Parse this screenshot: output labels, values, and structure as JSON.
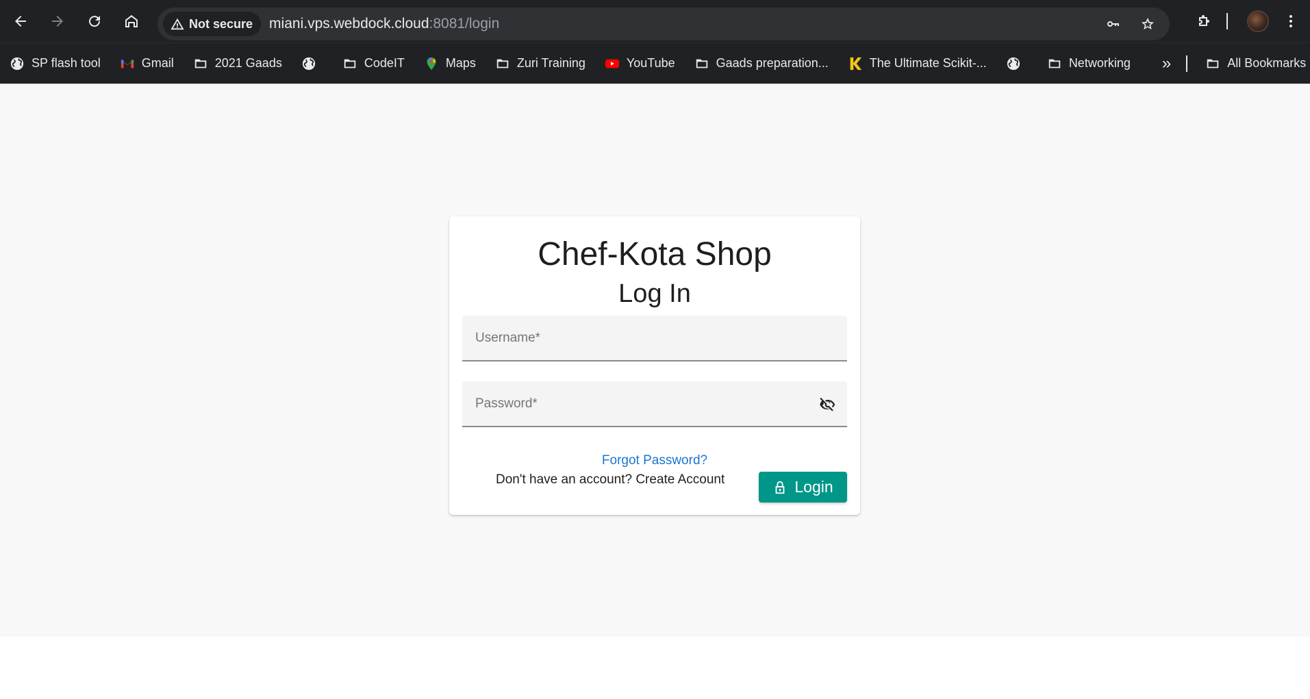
{
  "browser": {
    "security_label": "Not secure",
    "url_host": "miani.vps.webdock.cloud",
    "url_path": ":8081/login",
    "bookmarks": [
      {
        "label": "SP flash tool",
        "icon": "globe-icon"
      },
      {
        "label": "Gmail",
        "icon": "gmail-icon"
      },
      {
        "label": "2021 Gaads",
        "icon": "folder-icon"
      },
      {
        "label": "",
        "icon": "globe-icon"
      },
      {
        "label": "CodeIT",
        "icon": "folder-icon"
      },
      {
        "label": "Maps",
        "icon": "maps-icon"
      },
      {
        "label": "Zuri Training",
        "icon": "folder-icon"
      },
      {
        "label": "YouTube",
        "icon": "youtube-icon"
      },
      {
        "label": "Gaads preparation...",
        "icon": "folder-icon"
      },
      {
        "label": "The Ultimate Scikit-...",
        "icon": "k-icon"
      },
      {
        "label": "",
        "icon": "globe-icon"
      },
      {
        "label": "Networking",
        "icon": "folder-icon"
      }
    ],
    "overflow_label": "»",
    "all_bookmarks_label": "All Bookmarks"
  },
  "login": {
    "shop_title": "Chef-Kota Shop",
    "form_title": "Log In",
    "username_placeholder": "Username*",
    "password_placeholder": "Password*",
    "forgot_link": "Forgot Password?",
    "no_account_text": "Don't have an account?",
    "create_account_link": "Create Account",
    "login_button": "Login"
  },
  "colors": {
    "primary_button": "#009688",
    "link": "#1976d2",
    "browser_bg": "#202124"
  }
}
